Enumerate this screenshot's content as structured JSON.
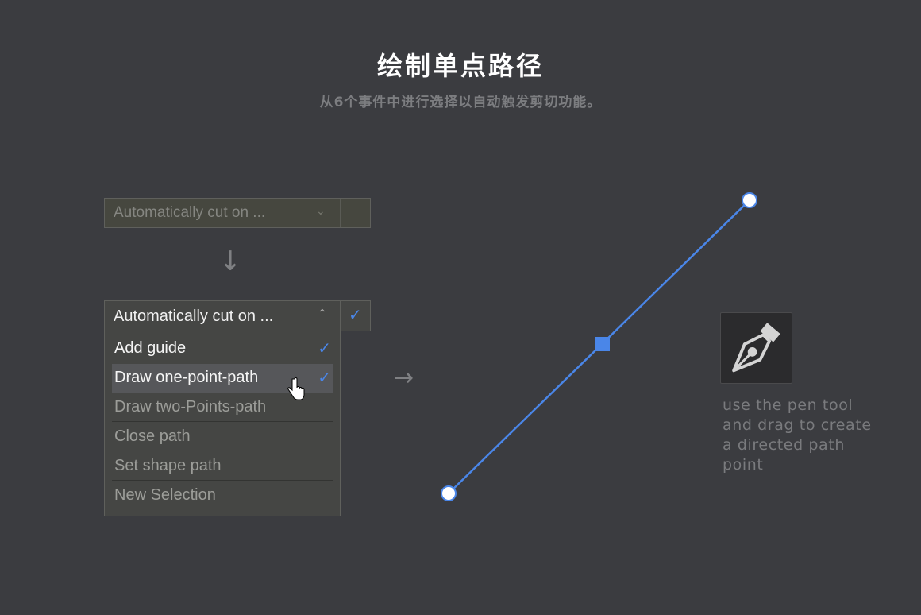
{
  "header": {
    "title": "绘制单点路径",
    "subtitle": "从6个事件中进行选择以自动触发剪切功能。"
  },
  "closed_dropdown": {
    "label": "Automatically cut on ...",
    "chevron_icon": "chevron-down-icon",
    "checkbox_checked": false
  },
  "open_dropdown": {
    "label": "Automatically cut on ...",
    "chevron_icon": "chevron-up-icon",
    "checkbox_checked": true,
    "items": [
      {
        "label": "Add guide",
        "checked": true,
        "enabled": true
      },
      {
        "label": "Draw one-point-path",
        "checked": true,
        "enabled": true,
        "hovered": true
      },
      {
        "label": "Draw two-Points-path",
        "checked": false,
        "enabled": false
      },
      {
        "label": "Close path",
        "checked": false,
        "enabled": false
      },
      {
        "label": "Set shape path",
        "checked": false,
        "enabled": false
      },
      {
        "label": "New Selection",
        "checked": false,
        "enabled": false
      }
    ]
  },
  "glyphs": {
    "check": "✓",
    "chevron_down": "⌄",
    "chevron_up": "⌃",
    "arrow_down": "↓",
    "arrow_right": "→"
  },
  "illustration": {
    "line_color": "#4a86e8",
    "anchor_fill": "#ffffff",
    "description": "use the pen tool and drag to create a directed path point",
    "description_lines": [
      "use the pen tool",
      "and drag to create",
      "a directed path",
      "point"
    ],
    "tool_icon": "pen-tool-icon"
  }
}
